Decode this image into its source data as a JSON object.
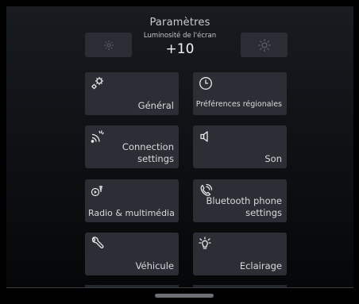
{
  "header": {
    "title": "Paramètres"
  },
  "brightness": {
    "label": "Luminosité de l'écran",
    "value": "+10",
    "decrease_icon": "sun-dim-icon",
    "increase_icon": "sun-bright-icon"
  },
  "tiles": [
    {
      "label": "Général",
      "icon": "gears-icon"
    },
    {
      "label": "Préférences régionales",
      "icon": "clock-icon"
    },
    {
      "label": "Connection settings",
      "line1": "Connection",
      "line2": "settings",
      "icon": "wireless-icon"
    },
    {
      "label": "Son",
      "icon": "speaker-icon"
    },
    {
      "label": "Radio & multimédia",
      "icon": "radio-media-icon"
    },
    {
      "label": "Bluetooth phone settings",
      "line1": "Bluetooth phone",
      "line2": "settings",
      "icon": "bluetooth-phone-icon"
    },
    {
      "label": "Véhicule",
      "icon": "wrench-icon"
    },
    {
      "label": "Eclairage",
      "icon": "lightbulb-icon"
    }
  ],
  "colors": {
    "tile_bg": "#2b2f35",
    "screen_bg_top": "#181b20",
    "text": "#d8dadd"
  }
}
